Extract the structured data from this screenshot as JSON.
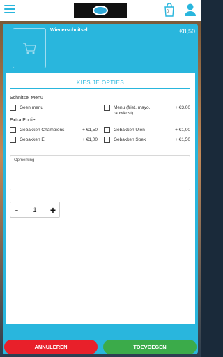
{
  "header": {
    "cart_count": "0"
  },
  "product": {
    "name": "Wienerschnitsel",
    "price": "€8,50"
  },
  "options": {
    "title": "KIES JE OPTIES",
    "sections": [
      {
        "title": "Schnitsel Menu",
        "items": [
          {
            "label": "Geen menu",
            "price": ""
          },
          {
            "label": "Menu (friet, mayo, rauwkost)",
            "price": "+ €3,00"
          }
        ]
      },
      {
        "title": "Extra Portie",
        "items": [
          {
            "label": "Gebakken Champions",
            "price": "+ €1,50"
          },
          {
            "label": "Gebakken Uien",
            "price": "+ €1,00"
          },
          {
            "label": "Gebakken Ei",
            "price": "+ €1,00"
          },
          {
            "label": "Gebakken Spek",
            "price": "+ €1,50"
          }
        ]
      }
    ]
  },
  "remark": {
    "label": "Opmerking"
  },
  "quantity": {
    "minus": "-",
    "value": "1",
    "plus": "+"
  },
  "actions": {
    "cancel_label": "ANNULEREN",
    "add_label": "TOEVOEGEN"
  }
}
